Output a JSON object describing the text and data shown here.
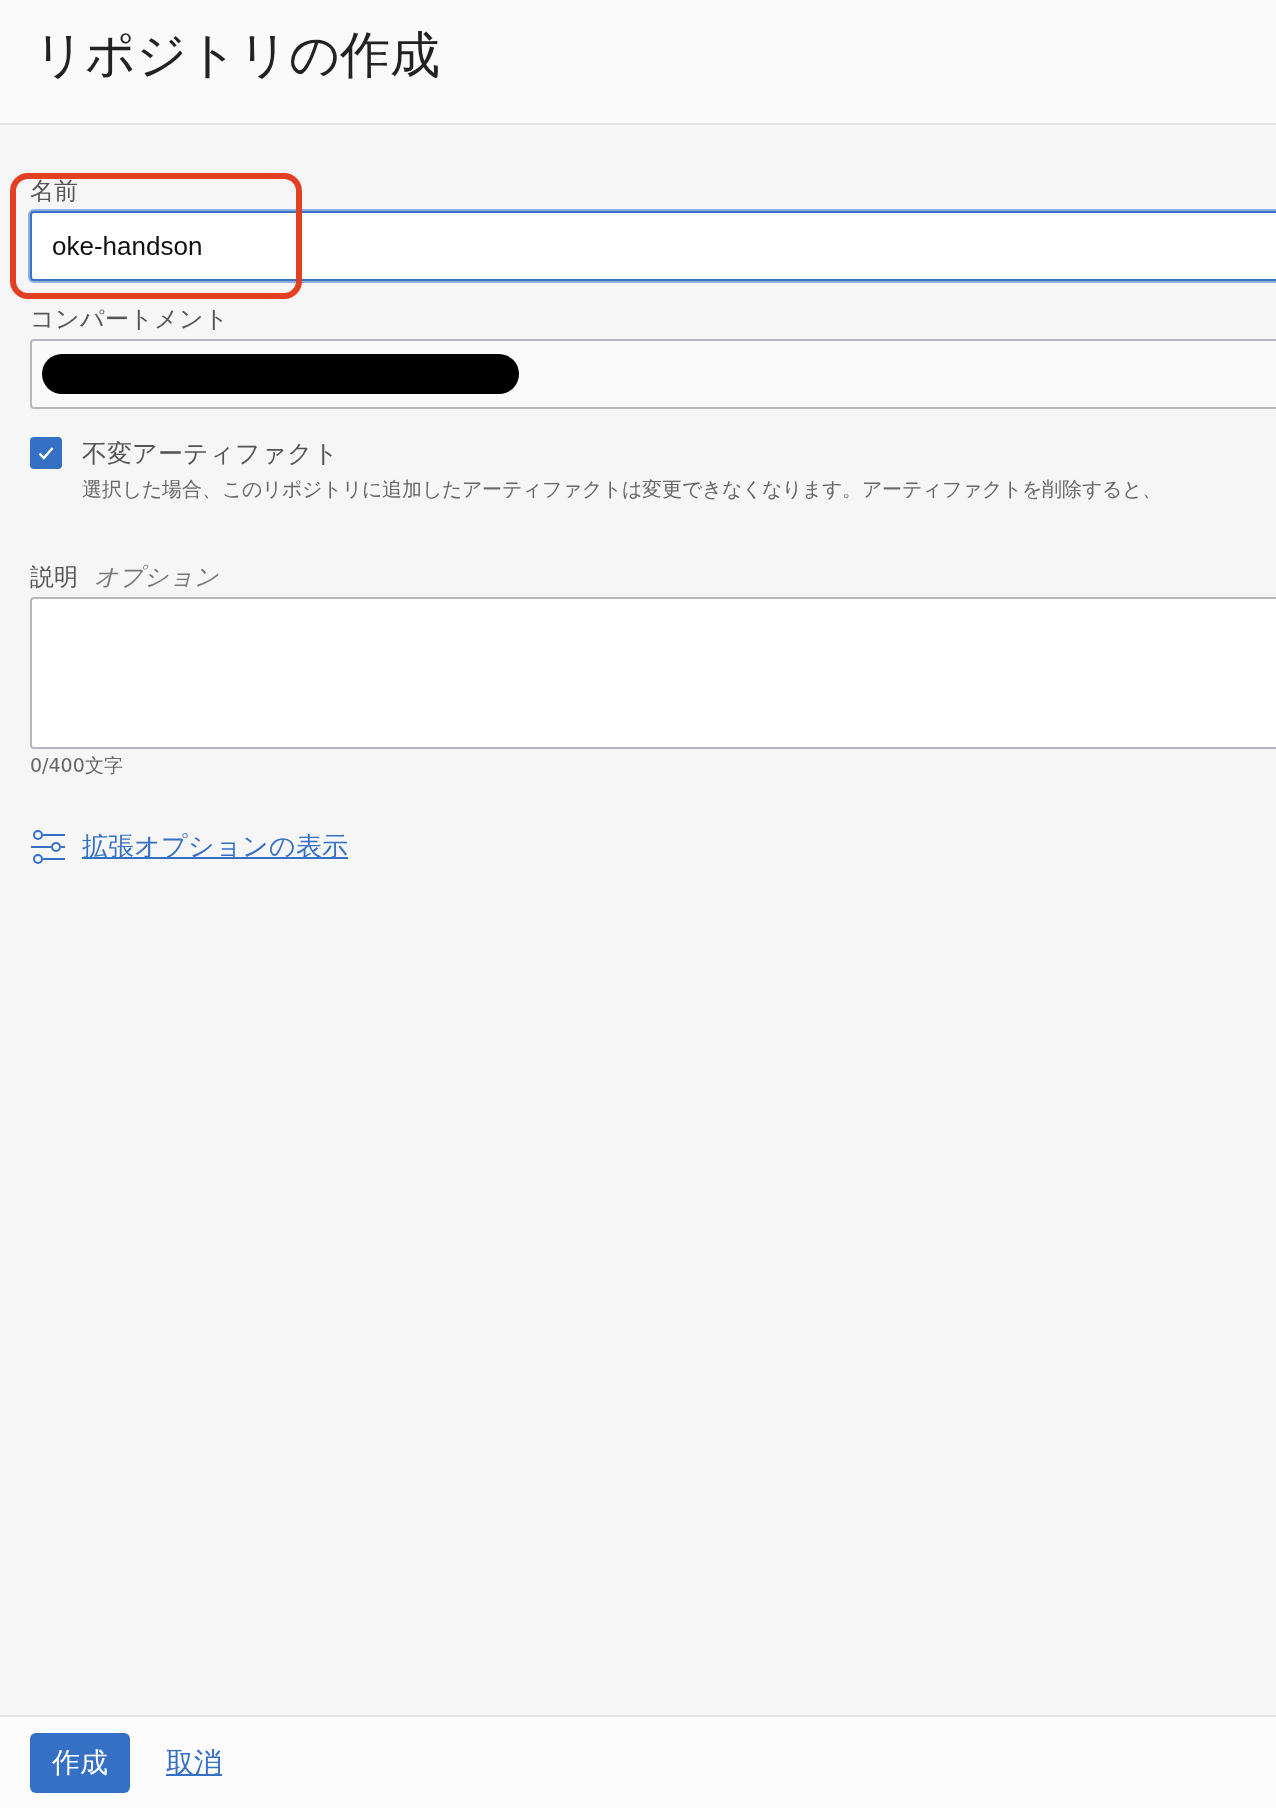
{
  "header": {
    "title": "リポジトリの作成"
  },
  "form": {
    "name_field": {
      "label": "名前",
      "value": "oke-handson",
      "focused": true,
      "annotated": true
    },
    "compartment_field": {
      "label": "コンパートメント"
    },
    "immutable_option": {
      "label": "不変アーティファクト",
      "description": "選択した場合、このリポジトリに追加したアーティファクトは変更できなくなります。アーティファクトを削除すると、",
      "checked": true
    },
    "description_field": {
      "label": "説明",
      "hint": "オプション",
      "counter": "0/400文字"
    },
    "advanced_link": "拡張オプションの表示"
  },
  "footer": {
    "buttons": [
      {
        "kind": "primary",
        "label": "作成"
      },
      {
        "kind": "link",
        "label": "取消"
      }
    ]
  }
}
